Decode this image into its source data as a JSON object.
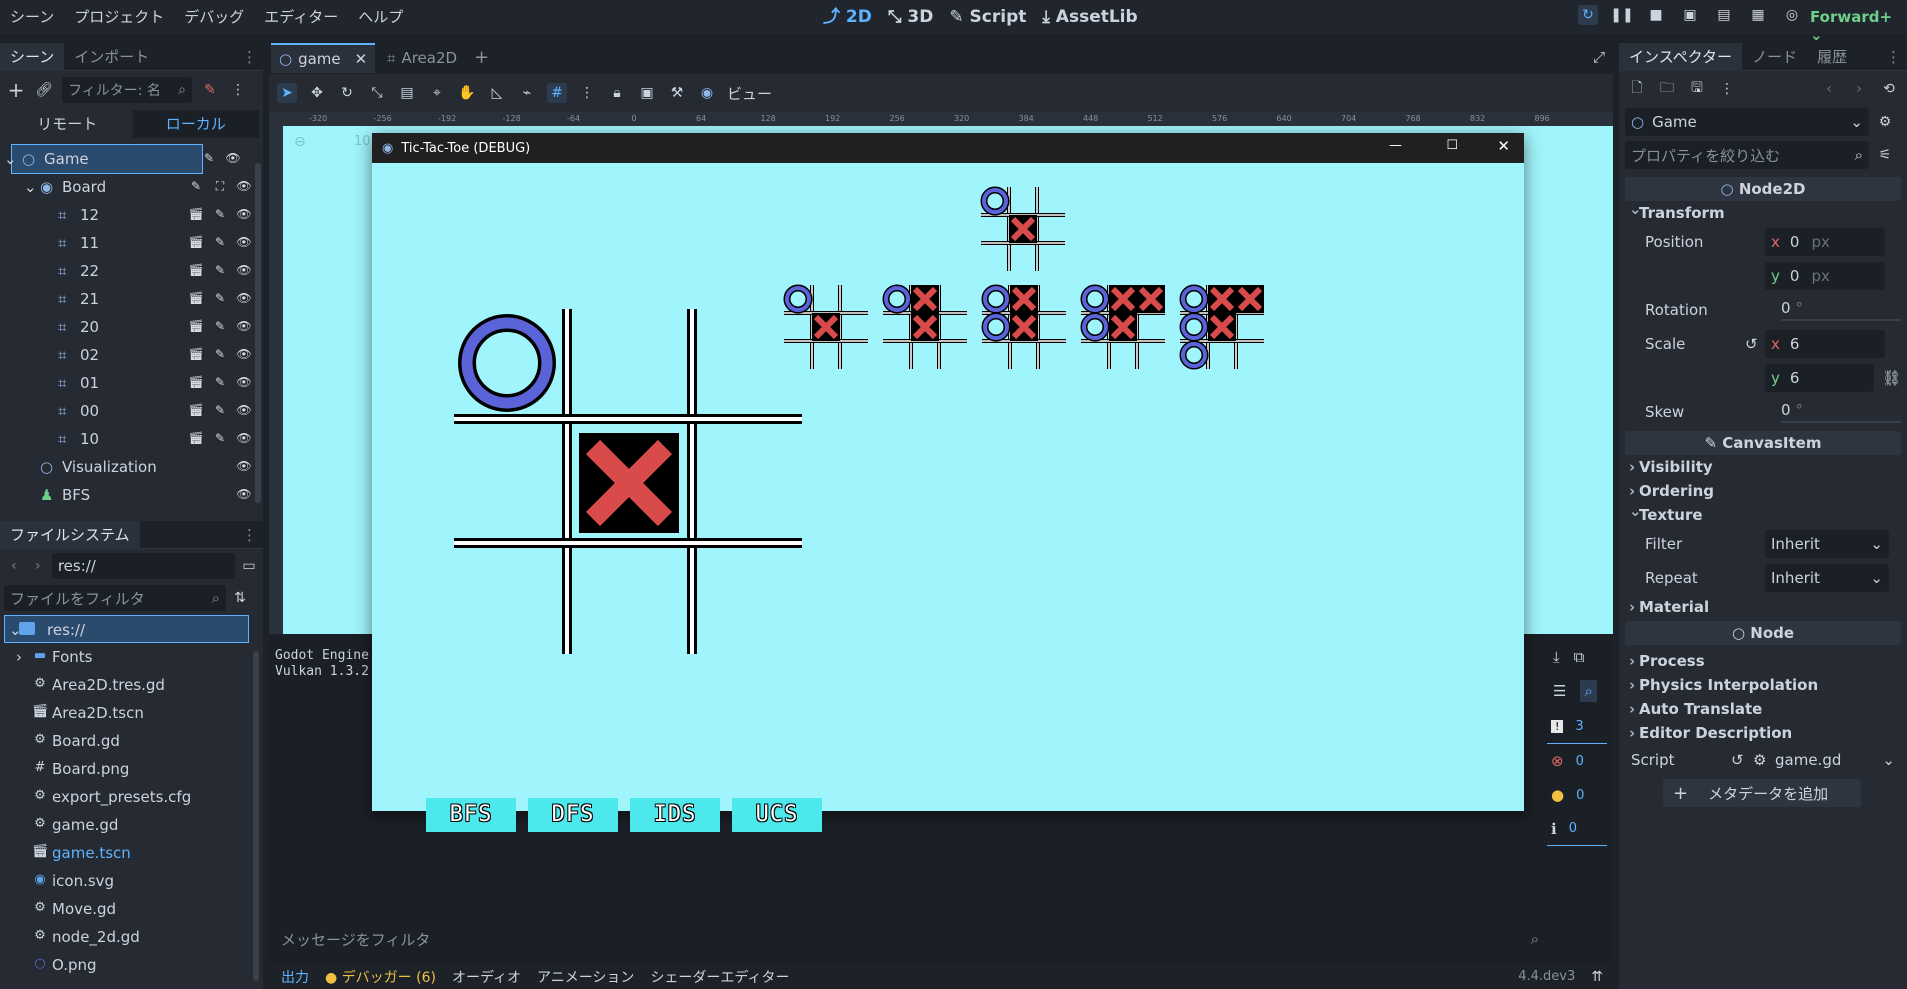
{
  "menu": [
    "シーン",
    "プロジェクト",
    "デバッグ",
    "エディター",
    "ヘルプ"
  ],
  "workspaces": {
    "w2d": "2D",
    "w3d": "3D",
    "script": "Script",
    "assetlib": "AssetLib"
  },
  "renderer": "Forward+",
  "scene_dock": {
    "tabs": [
      "シーン",
      "インポート"
    ],
    "filter_placeholder": "フィルター: 名",
    "remote": "リモート",
    "local": "ローカル",
    "tree": [
      {
        "label": "Game",
        "indent": 0,
        "icon": "node2d-icon",
        "selected": true
      },
      {
        "label": "Board",
        "indent": 1,
        "icon": "board-icon"
      },
      {
        "label": "12",
        "indent": 2,
        "icon": "area2d-icon"
      },
      {
        "label": "11",
        "indent": 2,
        "icon": "area2d-icon"
      },
      {
        "label": "22",
        "indent": 2,
        "icon": "area2d-icon"
      },
      {
        "label": "21",
        "indent": 2,
        "icon": "area2d-icon"
      },
      {
        "label": "20",
        "indent": 2,
        "icon": "area2d-icon"
      },
      {
        "label": "02",
        "indent": 2,
        "icon": "area2d-icon"
      },
      {
        "label": "01",
        "indent": 2,
        "icon": "area2d-icon"
      },
      {
        "label": "00",
        "indent": 2,
        "icon": "area2d-icon"
      },
      {
        "label": "10",
        "indent": 2,
        "icon": "area2d-icon"
      },
      {
        "label": "Visualization",
        "indent": 1,
        "icon": "node2d-icon"
      },
      {
        "label": "BFS",
        "indent": 1,
        "icon": "person-icon"
      }
    ]
  },
  "filesystem": {
    "title": "ファイルシステム",
    "path": "res://",
    "filter_placeholder": "ファイルをフィルタ",
    "root": "res://",
    "files": [
      {
        "name": "Fonts",
        "icon": "folder-icon"
      },
      {
        "name": "Area2D.tres.gd",
        "icon": "gear-icon"
      },
      {
        "name": "Area2D.tscn",
        "icon": "scene-icon"
      },
      {
        "name": "Board.gd",
        "icon": "gear-icon"
      },
      {
        "name": "Board.png",
        "icon": "grid-icon"
      },
      {
        "name": "export_presets.cfg",
        "icon": "gear-icon"
      },
      {
        "name": "game.gd",
        "icon": "gear-icon"
      },
      {
        "name": "game.tscn",
        "icon": "scene-icon",
        "highlight": true
      },
      {
        "name": "icon.svg",
        "icon": "godot-icon"
      },
      {
        "name": "Move.gd",
        "icon": "gear-icon"
      },
      {
        "name": "node_2d.gd",
        "icon": "gear-icon"
      },
      {
        "name": "O.png",
        "icon": "o-icon"
      }
    ]
  },
  "editor_tabs": [
    "game",
    "Area2D"
  ],
  "toolbar": {
    "view": "ビュー"
  },
  "ruler_labels": [
    "-320",
    "-256",
    "-192",
    "-128",
    "-64",
    "0",
    "64",
    "128",
    "192",
    "256",
    "320",
    "384",
    "448",
    "512",
    "576",
    "640",
    "704",
    "768",
    "832",
    "896"
  ],
  "zoom_label": "10",
  "game_window": {
    "title": "Tic-Tac-Toe (DEBUG)",
    "buttons": [
      "BFS",
      "DFS",
      "IDS",
      "UCS"
    ]
  },
  "output": {
    "lines": [
      "Godot Engine",
      "Vulkan 1.3.2"
    ],
    "filter_placeholder": "メッセージをフィルタ",
    "counts": {
      "errors_total": "3",
      "errors": "0",
      "warnings": "0",
      "info": "0"
    }
  },
  "bottom_tabs": [
    "出力",
    "デバッガー (6)",
    "オーディオ",
    "アニメーション",
    "シェーダーエディター"
  ],
  "version": "4.4.dev3",
  "inspector": {
    "tabs": [
      "インスペクター",
      "ノード",
      "履歴"
    ],
    "node_name": "Game",
    "filter_placeholder": "プロパティを絞り込む",
    "class_node2d": "Node2D",
    "transform": "Transform",
    "position": {
      "label": "Position",
      "x": "0",
      "y": "0",
      "unit": "px"
    },
    "rotation": {
      "label": "Rotation",
      "value": "0",
      "unit": "°"
    },
    "scale": {
      "label": "Scale",
      "x": "6",
      "y": "6"
    },
    "skew": {
      "label": "Skew",
      "value": "0",
      "unit": "°"
    },
    "canvas_item": "CanvasItem",
    "visibility": "Visibility",
    "ordering": "Ordering",
    "texture": "Texture",
    "filter": {
      "label": "Filter",
      "value": "Inherit"
    },
    "repeat": {
      "label": "Repeat",
      "value": "Inherit"
    },
    "material": "Material",
    "node": "Node",
    "process": "Process",
    "physics_interp": "Physics Interpolation",
    "auto_translate": "Auto Translate",
    "editor_desc": "Editor Description",
    "script": {
      "label": "Script",
      "value": "game.gd"
    },
    "add_metadata": "メタデータを追加"
  },
  "colors": {
    "accent": "#5fb2ff",
    "game_bg": "#a0f4fb",
    "o_color": "#5b63d8",
    "x_color": "#d94a4a"
  }
}
